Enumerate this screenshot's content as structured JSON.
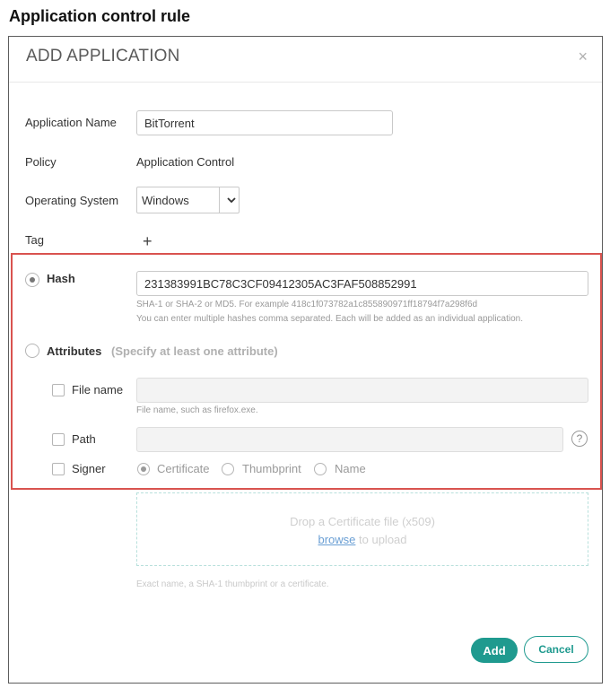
{
  "caption": "Application control rule",
  "dialog": {
    "title": "ADD APPLICATION",
    "close_glyph": "×"
  },
  "form": {
    "app_name_label": "Application Name",
    "app_name_value": "BitTorrent",
    "policy_label": "Policy",
    "policy_value": "Application Control",
    "os_label": "Operating System",
    "os_value": "Windows",
    "tag_label": "Tag",
    "tag_add_glyph": "+"
  },
  "hash": {
    "label": "Hash",
    "selected": true,
    "value": "231383991BC78C3CF09412305AC3FAF508852991",
    "hint1": "SHA-1 or SHA-2 or MD5. For example 418c1f073782a1c855890971ff18794f7a298f6d",
    "hint2": "You can enter multiple hashes comma separated. Each will be added as an individual application."
  },
  "attributes": {
    "label": "Attributes",
    "note": "(Specify at least one attribute)",
    "selected": false,
    "file_name_label": "File name",
    "file_name_hint": "File name, such as firefox.exe.",
    "path_label": "Path",
    "help_glyph": "?",
    "signer_label": "Signer",
    "signer_options": [
      "Certificate",
      "Thumbprint",
      "Name"
    ],
    "signer_selected": "Certificate"
  },
  "dropzone": {
    "line1": "Drop a Certificate file (x509)",
    "browse": "browse",
    "after_browse": " to upload",
    "hint": "Exact name, a SHA-1 thumbprint or a certificate."
  },
  "buttons": {
    "add": "Add",
    "cancel": "Cancel"
  },
  "colors": {
    "accent": "#1f9a8f",
    "highlight": "#d9534f"
  }
}
